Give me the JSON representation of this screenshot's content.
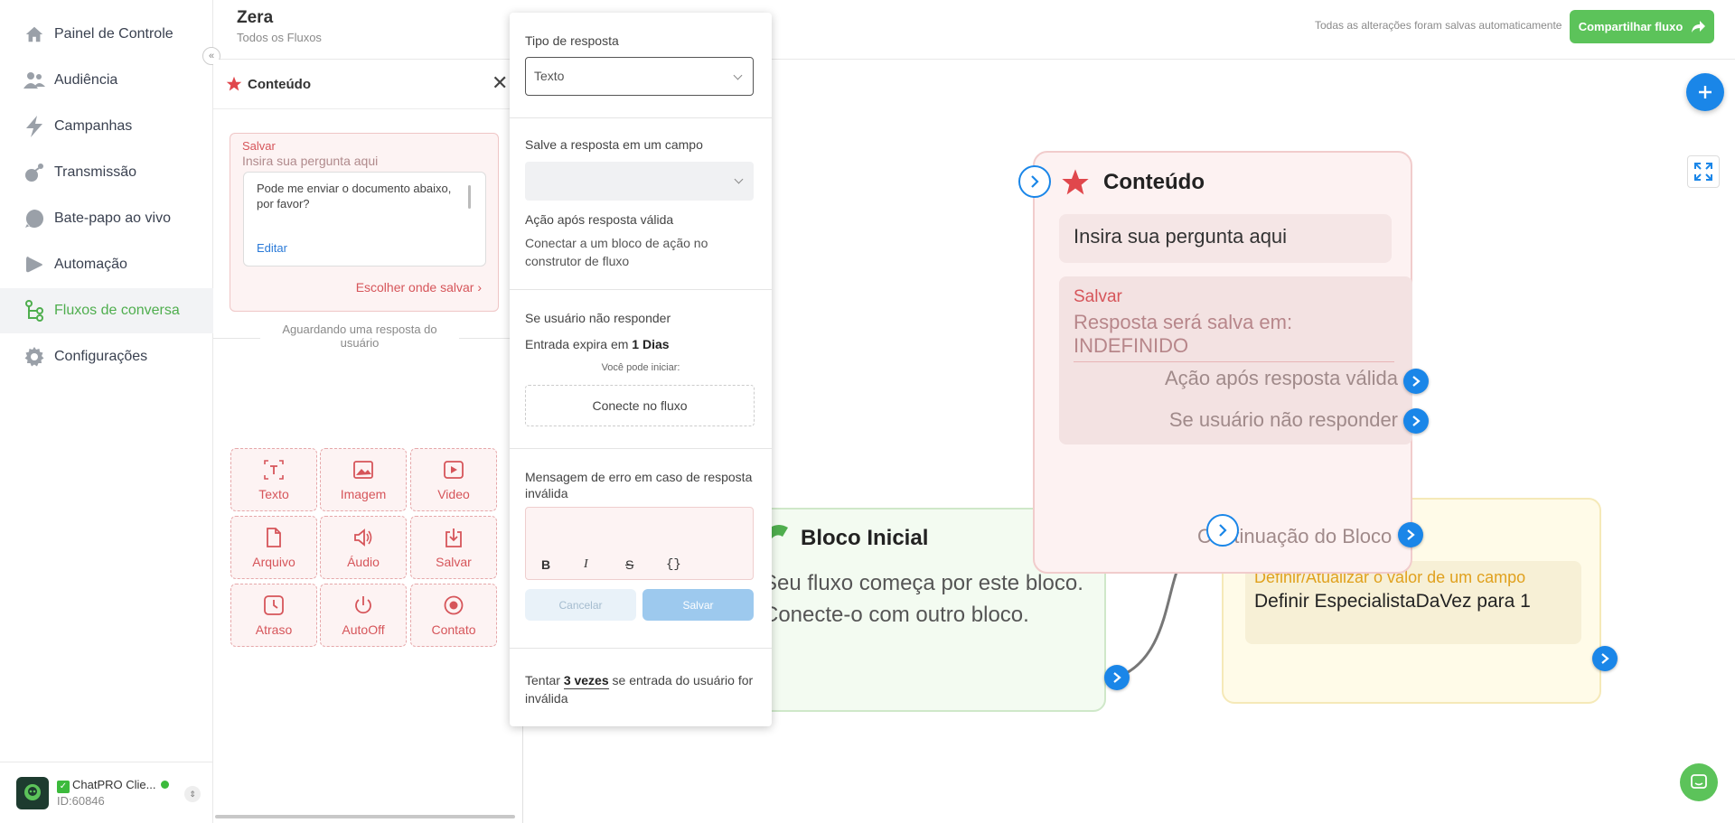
{
  "nav": {
    "items": [
      {
        "label": "Painel de Controle",
        "icon": "home-icon"
      },
      {
        "label": "Audiência",
        "icon": "users-icon"
      },
      {
        "label": "Campanhas",
        "icon": "lightning-icon"
      },
      {
        "label": "Transmissão",
        "icon": "broadcast-icon"
      },
      {
        "label": "Bate-papo ao vivo",
        "icon": "chat-bubble-icon"
      },
      {
        "label": "Automação",
        "icon": "play-icon"
      },
      {
        "label": "Fluxos de conversa",
        "icon": "flow-icon"
      },
      {
        "label": "Configurações",
        "icon": "gear-icon"
      }
    ],
    "active_index": 6,
    "account_name": "ChatPRO Clie...",
    "account_id": "ID:60846"
  },
  "header": {
    "title": "Zera",
    "subtitle": "Todos os Fluxos",
    "autosave": "Todas as alterações foram salvas automaticamente",
    "share_label": "Compartilhar fluxo"
  },
  "content_panel": {
    "title": "Conteúdo",
    "save_label": "Salvar",
    "question_placeholder": "Insira sua pergunta aqui",
    "message": "Pode me enviar o documento abaixo, por favor?",
    "edit_label": "Editar",
    "choose_save_label": "Escolher onde salvar",
    "waiting_label": "Aguardando uma resposta do usuário",
    "tiles": [
      {
        "label": "Texto",
        "icon": "text-icon"
      },
      {
        "label": "Imagem",
        "icon": "image-icon"
      },
      {
        "label": "Video",
        "icon": "video-icon"
      },
      {
        "label": "Arquivo",
        "icon": "file-icon"
      },
      {
        "label": "Áudio",
        "icon": "audio-icon"
      },
      {
        "label": "Salvar",
        "icon": "save-icon"
      },
      {
        "label": "Atraso",
        "icon": "clock-icon"
      },
      {
        "label": "AutoOff",
        "icon": "power-icon"
      },
      {
        "label": "Contato",
        "icon": "contact-icon"
      }
    ]
  },
  "popup": {
    "response_type_label": "Tipo de resposta",
    "response_type_value": "Texto",
    "save_field_label": "Salve a resposta em um campo",
    "save_field_value": "",
    "action_valid_title": "Ação após resposta válida",
    "action_valid_desc": "Conectar a um bloco de ação no construtor de fluxo",
    "no_response_title": "Se usuário não responder",
    "expires_prefix": "Entrada expira em",
    "expires_value": "1 Dias",
    "can_start": "Você pode iniciar:",
    "connect_label": "Conecte no fluxo",
    "error_msg_label": "Mensagem de erro em caso de resposta inválida",
    "toolbar": {
      "bold": "B",
      "italic": "I",
      "strike": "S",
      "code": "{}"
    },
    "cancel_label": "Cancelar",
    "save_label": "Salvar",
    "retry_prefix": "Tentar",
    "retry_value": "3 vezes",
    "retry_suffix": "se entrada do usuário for inválida"
  },
  "canvas": {
    "content_node": {
      "title": "Conteúdo",
      "question": "Insira sua pergunta aqui",
      "save_title": "Salvar",
      "save_text": "Resposta será salva em: INDEFINIDO",
      "valid_action": "Ação após resposta válida",
      "no_response": "Se usuário não responder",
      "continuation": "Continuação do Bloco"
    },
    "start_node": {
      "title": "Bloco Inicial",
      "body": "Seu fluxo começa por este bloco. Conecte-o com outro bloco."
    },
    "set_node": {
      "label": "Definir/Atualizar o valor de um campo",
      "value": "Definir EspecialistaDaVez para 1"
    }
  },
  "colors": {
    "accent_green": "#5cc35a",
    "connector_blue": "#1a86e8",
    "content_red": "#d6555a"
  }
}
